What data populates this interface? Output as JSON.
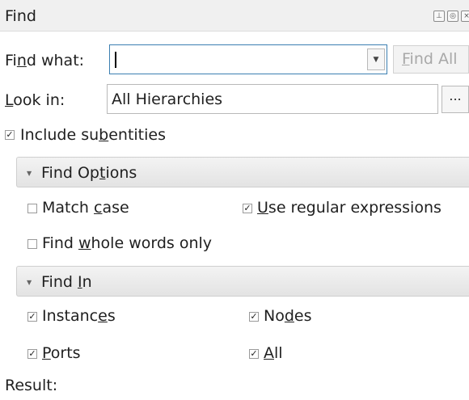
{
  "window": {
    "title": "Find",
    "title_buttons": [
      "pin-icon",
      "float-icon",
      "close-icon"
    ]
  },
  "find_what": {
    "label": "Find what:",
    "value": "",
    "find_all_label": "Find All"
  },
  "look_in": {
    "label": "Look in:",
    "value": "All Hierarchies",
    "browse_label": "..."
  },
  "include_subentities": {
    "label": "Include subentities",
    "checked": true
  },
  "find_options": {
    "header": "Find Options",
    "match_case": {
      "label": "Match case",
      "checked": false
    },
    "use_regex": {
      "label": "Use regular expressions",
      "checked": true
    },
    "whole_words": {
      "label": "Find whole words only",
      "checked": false
    }
  },
  "find_in": {
    "header": "Find In",
    "instances": {
      "label": "Instances",
      "checked": true
    },
    "nodes": {
      "label": "Nodes",
      "checked": true
    },
    "ports": {
      "label": "Ports",
      "checked": true
    },
    "all": {
      "label": "All",
      "checked": true
    }
  },
  "result": {
    "label": "Result:"
  }
}
